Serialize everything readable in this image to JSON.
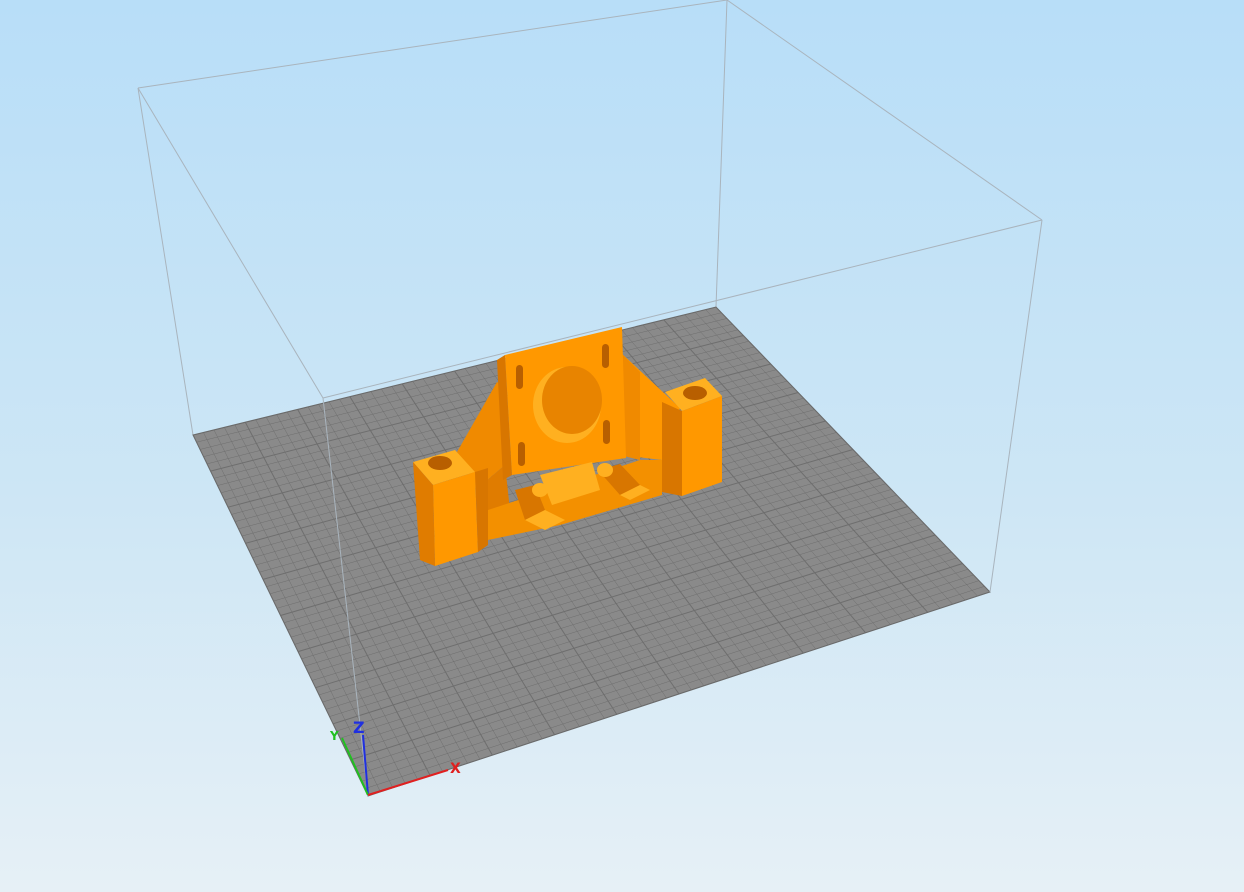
{
  "viewport": {
    "background_top": "#b8def8",
    "background_bottom": "#e6f0f6"
  },
  "build_plate": {
    "color": "#8a8a8a",
    "grid_color": "#6e6e6e"
  },
  "build_volume": {
    "edge_color": "#a9b4bd"
  },
  "model": {
    "color": "#ff9800"
  },
  "axes": {
    "x_label": "X",
    "y_label": "Y",
    "z_label": "Z",
    "x_color": "#e02020",
    "y_color": "#20c020",
    "z_color": "#2030e0"
  }
}
